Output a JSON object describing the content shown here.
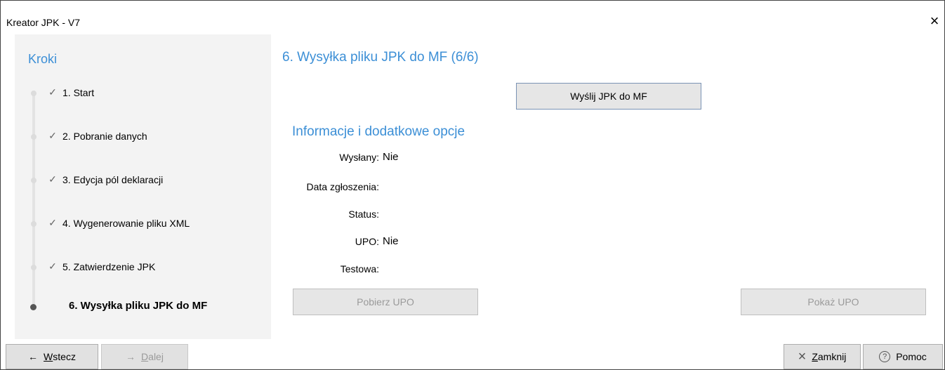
{
  "window": {
    "title": "Kreator JPK - V7",
    "close_icon": "×"
  },
  "sidebar": {
    "heading": "Kroki",
    "steps": [
      {
        "label": "1. Start",
        "state": "done"
      },
      {
        "label": "2. Pobranie danych",
        "state": "done"
      },
      {
        "label": "3. Edycja pól deklaracji",
        "state": "done"
      },
      {
        "label": "4. Wygenerowanie pliku XML",
        "state": "done"
      },
      {
        "label": "5. Zatwierdzenie JPK",
        "state": "done"
      },
      {
        "label": "6. Wysyłka pliku JPK do MF",
        "state": "active"
      }
    ]
  },
  "main": {
    "title": "6. Wysyłka pliku JPK do MF (6/6)",
    "send_button": "Wyślij JPK do MF",
    "info_title": "Informacje i dodatkowe opcje",
    "fields": {
      "sent_label": "Wysłany:",
      "sent_value": "Nie",
      "date_label": "Data zgłoszenia:",
      "date_value": "",
      "status_label": "Status:",
      "status_value": "",
      "upo_label": "UPO:",
      "upo_value": "Nie",
      "test_label": "Testowa:",
      "test_value": ""
    },
    "download_upo": "Pobierz UPO",
    "show_upo": "Pokaż UPO"
  },
  "footer": {
    "back_arrow": "←",
    "back_access": "W",
    "back_rest": "stecz",
    "next_arrow": "→",
    "next_access": "D",
    "next_rest": "alej",
    "close_icon": "×",
    "close_access": "Z",
    "close_rest": "amknij",
    "help_icon": "?",
    "help_label": "Pomoc"
  },
  "colors": {
    "accent": "#3c8fd6",
    "disabled_text": "#9a9a9a"
  }
}
